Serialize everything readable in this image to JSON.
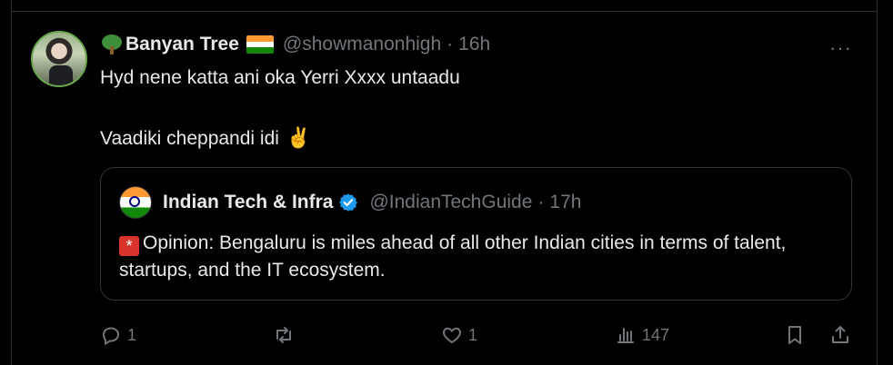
{
  "tweet": {
    "author_name": "Banyan Tree",
    "author_handle": "@showmanonhigh",
    "separator": "·",
    "time": "16h",
    "more_label": "···",
    "text_line1": "Hyd nene katta ani oka Yerri Xxxx untaadu",
    "text_line2": "Vaadiki cheppandi idi",
    "emoji_victory": "✌️"
  },
  "quote": {
    "author_name": "Indian Tech & Infra",
    "author_handle": "@IndianTechGuide",
    "separator": "·",
    "time": "17h",
    "siren_emoji": "🚨",
    "text": "Opinion: Bengaluru is miles ahead of all other Indian cities in terms of talent, startups, and the IT ecosystem."
  },
  "actions": {
    "reply_count": "1",
    "retweet_count": "",
    "like_count": "1",
    "view_count": "147"
  },
  "colors": {
    "background": "#000000",
    "text": "#e7e9ea",
    "muted": "#71767b",
    "border": "#2f3336",
    "verified": "#1d9bf0"
  },
  "icons": [
    "tree-icon",
    "india-flag-icon",
    "more-icon",
    "verified-icon",
    "siren-icon",
    "reply-icon",
    "retweet-icon",
    "like-icon",
    "views-icon",
    "bookmark-icon",
    "share-icon"
  ]
}
